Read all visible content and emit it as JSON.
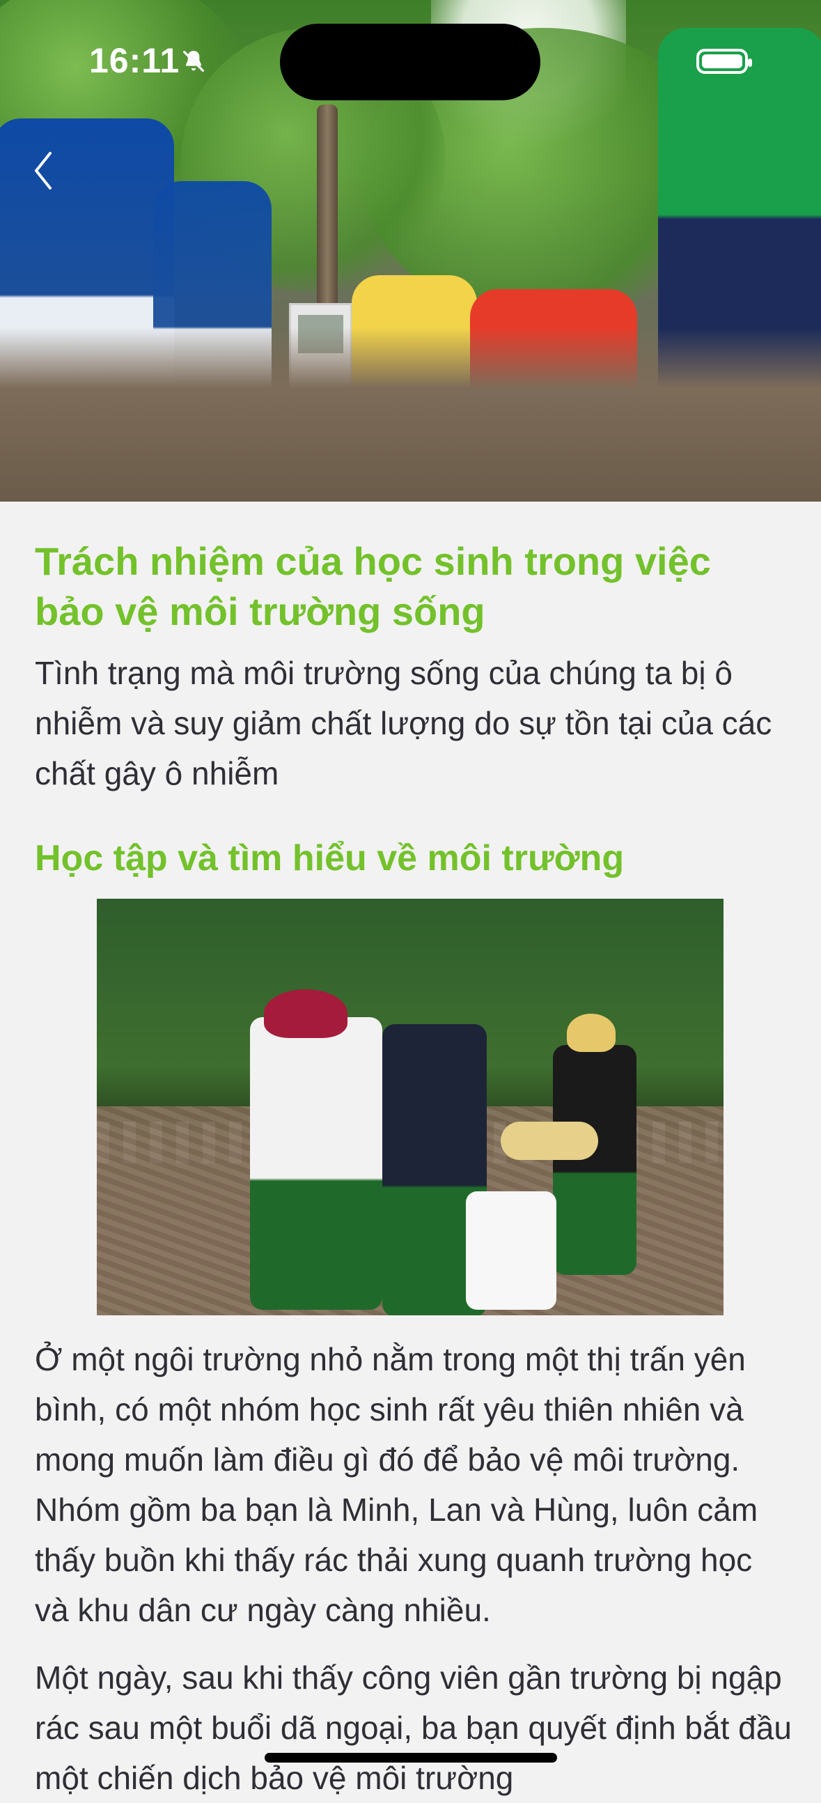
{
  "status_bar": {
    "time": "16:11",
    "icons": [
      "bell-slash-icon",
      "battery-icon"
    ]
  },
  "hero": {
    "image_name": "hero-image"
  },
  "article": {
    "title": "Trách nhiệm của học sinh trong việc bảo vệ môi trường sống",
    "intro": "Tình trạng mà môi trường sống của chúng ta bị ô nhiễm và suy giảm chất lượng do sự tồn tại của các chất gây ô nhiễm",
    "section_heading": "Học tập và tìm hiểu về môi trường",
    "paragraph_1": "Ở một ngôi trường nhỏ nằm trong một thị trấn yên bình, có một nhóm học sinh rất yêu thiên nhiên và mong muốn làm điều gì đó để bảo vệ môi trường. Nhóm gồm ba bạn là Minh, Lan và Hùng, luôn cảm thấy buồn khi thấy rác thải xung quanh trường học và khu dân cư ngày càng nhiều.",
    "paragraph_2": "Một ngày, sau khi thấy công viên gần trường bị ngập rác sau một buổi dã ngoại, ba bạn quyết định bắt đầu một chiến dịch bảo vệ môi trường"
  },
  "colors": {
    "accent_green": "#73c12b",
    "text_dark": "#2e2e36",
    "background": "#f2f2f2"
  }
}
